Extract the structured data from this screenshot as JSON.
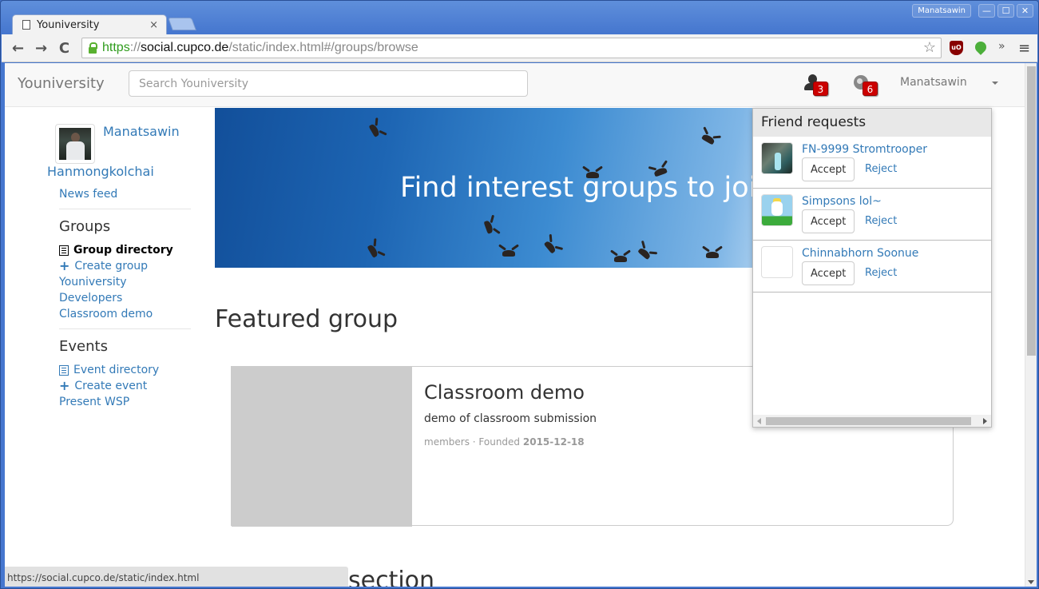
{
  "window": {
    "profile_name": "Manatsawin",
    "controls": {
      "minimize": "—",
      "maximize": "☐",
      "close": "✕"
    }
  },
  "browser": {
    "tab_title": "Youniversity",
    "tab_close": "×",
    "url": {
      "scheme": "https",
      "separator": "://",
      "host": "social.cupco.de",
      "path": "/static/index.html#/groups/browse"
    },
    "nav": {
      "back": "←",
      "forward": "→",
      "reload": "C"
    },
    "bookmark_star": "☆",
    "extensions": {
      "ublock_label": "uO",
      "overflow": "»"
    },
    "menu": "≡",
    "status_url": "https://social.cupco.de/static/index.html"
  },
  "navbar": {
    "brand": "Youniversity",
    "search_placeholder": "Search Youniversity",
    "search_value": "",
    "friend_request_count": "3",
    "notification_count": "6",
    "user_name": "Manatsawin"
  },
  "sidebar": {
    "first_name": "Manatsawin",
    "last_name": "Hanmongkolchai",
    "news_feed": "News feed",
    "groups_heading": "Groups",
    "groups": [
      {
        "label": "Group directory",
        "icon": "list-icon",
        "active": true
      },
      {
        "label": "Create group",
        "icon": "plus-icon"
      },
      {
        "label": "Youniversity"
      },
      {
        "label": "Developers"
      },
      {
        "label": "Classroom demo"
      }
    ],
    "events_heading": "Events",
    "events": [
      {
        "label": "Event directory",
        "icon": "list-icon"
      },
      {
        "label": "Create event",
        "icon": "plus-icon"
      },
      {
        "label": "Present WSP"
      }
    ]
  },
  "hero": {
    "title": "Find interest groups to join"
  },
  "featured": {
    "heading": "Featured group",
    "group": {
      "name": "Classroom demo",
      "description": "demo of classroom submission",
      "meta_prefix": "members · Founded",
      "founded": "2015-12-18"
    },
    "next_section_heading": "section"
  },
  "friend_requests": {
    "title": "Friend requests",
    "accept_label": "Accept",
    "reject_label": "Reject",
    "items": [
      {
        "name": "FN-9999 Stromtrooper",
        "avatar": "trooper"
      },
      {
        "name": "Simpsons lol~",
        "avatar": "simpsons"
      },
      {
        "name": "Chinnabhorn Soonue",
        "avatar": "blank"
      }
    ]
  },
  "colors": {
    "link": "#337ab7",
    "badge": "#cc0000",
    "url_scheme": "#2f9c1c"
  }
}
